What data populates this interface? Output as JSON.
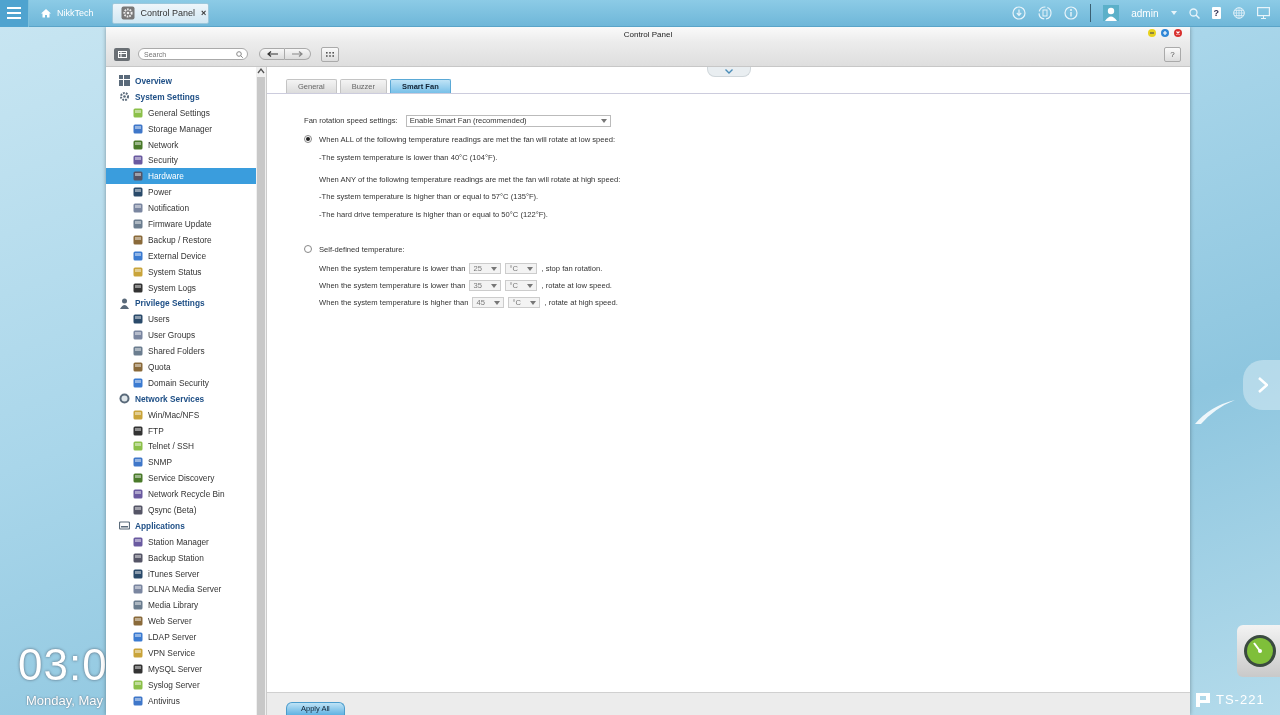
{
  "taskbar": {
    "apps": [
      {
        "label": "NikkTech",
        "selected": false
      },
      {
        "label": "Control Panel",
        "selected": true,
        "close": "×"
      }
    ],
    "user": "admin",
    "help": "?"
  },
  "desktop": {
    "clock": "03:0",
    "date": "Monday, May",
    "model": "TS-221"
  },
  "window": {
    "title": "Control Panel",
    "search": {
      "placeholder": "Search"
    },
    "help": "?",
    "sidebar": [
      {
        "label": "Overview",
        "selected": false
      },
      {
        "label": "System Settings",
        "selected": false,
        "children": [
          {
            "label": "General Settings",
            "selected": false
          },
          {
            "label": "Storage Manager",
            "selected": false
          },
          {
            "label": "Network",
            "selected": false
          },
          {
            "label": "Security",
            "selected": false
          },
          {
            "label": "Hardware",
            "selected": true
          },
          {
            "label": "Power",
            "selected": false
          },
          {
            "label": "Notification",
            "selected": false
          },
          {
            "label": "Firmware Update",
            "selected": false
          },
          {
            "label": "Backup / Restore",
            "selected": false
          },
          {
            "label": "External Device",
            "selected": false
          },
          {
            "label": "System Status",
            "selected": false
          },
          {
            "label": "System Logs",
            "selected": false
          }
        ]
      },
      {
        "label": "Privilege Settings",
        "selected": false,
        "children": [
          {
            "label": "Users",
            "selected": false
          },
          {
            "label": "User Groups",
            "selected": false
          },
          {
            "label": "Shared Folders",
            "selected": false
          },
          {
            "label": "Quota",
            "selected": false
          },
          {
            "label": "Domain Security",
            "selected": false
          }
        ]
      },
      {
        "label": "Network Services",
        "selected": false,
        "children": [
          {
            "label": "Win/Mac/NFS",
            "selected": false
          },
          {
            "label": "FTP",
            "selected": false
          },
          {
            "label": "Telnet / SSH",
            "selected": false
          },
          {
            "label": "SNMP",
            "selected": false
          },
          {
            "label": "Service Discovery",
            "selected": false
          },
          {
            "label": "Network Recycle Bin",
            "selected": false
          },
          {
            "label": "Qsync (Beta)",
            "selected": false
          }
        ]
      },
      {
        "label": "Applications",
        "selected": false,
        "children": [
          {
            "label": "Station Manager",
            "selected": false
          },
          {
            "label": "Backup Station",
            "selected": false
          },
          {
            "label": "iTunes Server",
            "selected": false
          },
          {
            "label": "DLNA Media Server",
            "selected": false
          },
          {
            "label": "Media Library",
            "selected": false
          },
          {
            "label": "Web Server",
            "selected": false
          },
          {
            "label": "LDAP Server",
            "selected": false
          },
          {
            "label": "VPN Service",
            "selected": false
          },
          {
            "label": "MySQL Server",
            "selected": false
          },
          {
            "label": "Syslog Server",
            "selected": false
          },
          {
            "label": "Antivirus",
            "selected": false
          }
        ]
      }
    ],
    "tabs": [
      {
        "label": "General",
        "selected": false
      },
      {
        "label": "Buzzer",
        "selected": false
      },
      {
        "label": "Smart Fan",
        "selected": true
      }
    ],
    "fan_setting": {
      "label": "Fan rotation speed settings:",
      "value": "Enable Smart Fan (recommended)"
    },
    "modes": [
      {
        "kind": "preset",
        "selected": true,
        "label": "When ALL of the following temperature readings are met the fan will rotate at low speed:",
        "lines": [
          {
            "kind": "condition",
            "text": "-The system temperature is lower than 40°C (104°F)."
          },
          {
            "kind": "heading",
            "text": "When ANY of the following temperature readings are met the fan will rotate at high speed:"
          },
          {
            "kind": "condition",
            "text": "-The system temperature is higher than or equal to 57°C (135°F)."
          },
          {
            "kind": "condition",
            "text": "-The hard drive temperature is higher than or equal to 50°C (122°F)."
          }
        ]
      },
      {
        "kind": "custom",
        "selected": false,
        "label": "Self-defined temperature:",
        "rows": [
          {
            "prefix": "When the system temperature is lower than",
            "value": "25",
            "unit": "°C",
            "suffix": ", stop fan rotation.",
            "disabled": true
          },
          {
            "prefix": "When the system temperature is lower than",
            "value": "35",
            "unit": "°C",
            "suffix": ", rotate at low speed.",
            "disabled": true
          },
          {
            "prefix": "When the system temperature is higher than",
            "value": "45",
            "unit": "°C",
            "suffix": ", rotate at high speed.",
            "disabled": true
          }
        ]
      }
    ],
    "apply_button": "Apply All"
  }
}
